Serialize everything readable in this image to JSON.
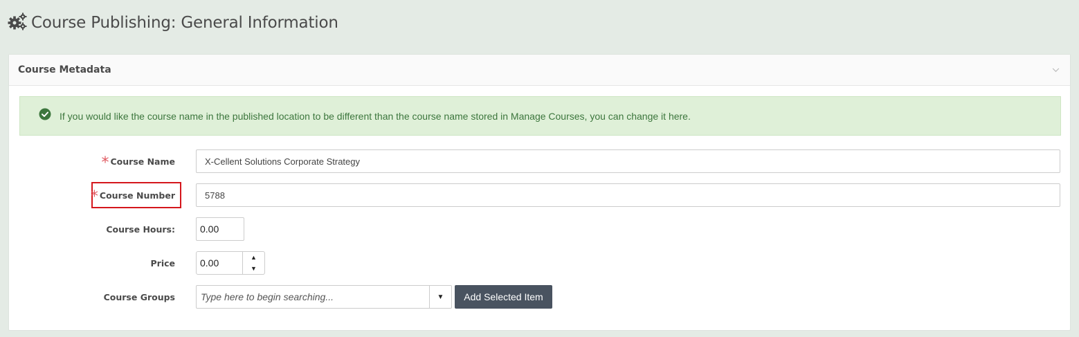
{
  "page": {
    "title": "Course Publishing: General Information",
    "icon": "gears-icon"
  },
  "panel": {
    "title": "Course Metadata",
    "collapse_icon": "chevron-down-icon"
  },
  "alert": {
    "icon": "check-circle-icon",
    "text": "If you would like the course name in the published location to be different than the course name stored in Manage Courses, you can change it here."
  },
  "form": {
    "course_name": {
      "label": "Course Name",
      "required_mark": "*",
      "value": "X-Cellent Solutions Corporate Strategy"
    },
    "course_number": {
      "label": "Course Number",
      "required_mark": "*",
      "value": "5788"
    },
    "course_hours": {
      "label": "Course Hours:",
      "value": "0.00"
    },
    "price": {
      "label": "Price",
      "value": "0.00",
      "up_arrow": "▲",
      "down_arrow": "▼"
    },
    "course_groups": {
      "label": "Course Groups",
      "placeholder": "Type here to begin searching...",
      "dropdown_arrow": "▼"
    },
    "add_button": "Add Selected Item"
  },
  "colors": {
    "background": "#e4ebe5",
    "alert_bg": "#dff0d8",
    "alert_text": "#3c763d",
    "required": "#e05a62",
    "highlight": "#d4161c",
    "button": "#495360"
  }
}
